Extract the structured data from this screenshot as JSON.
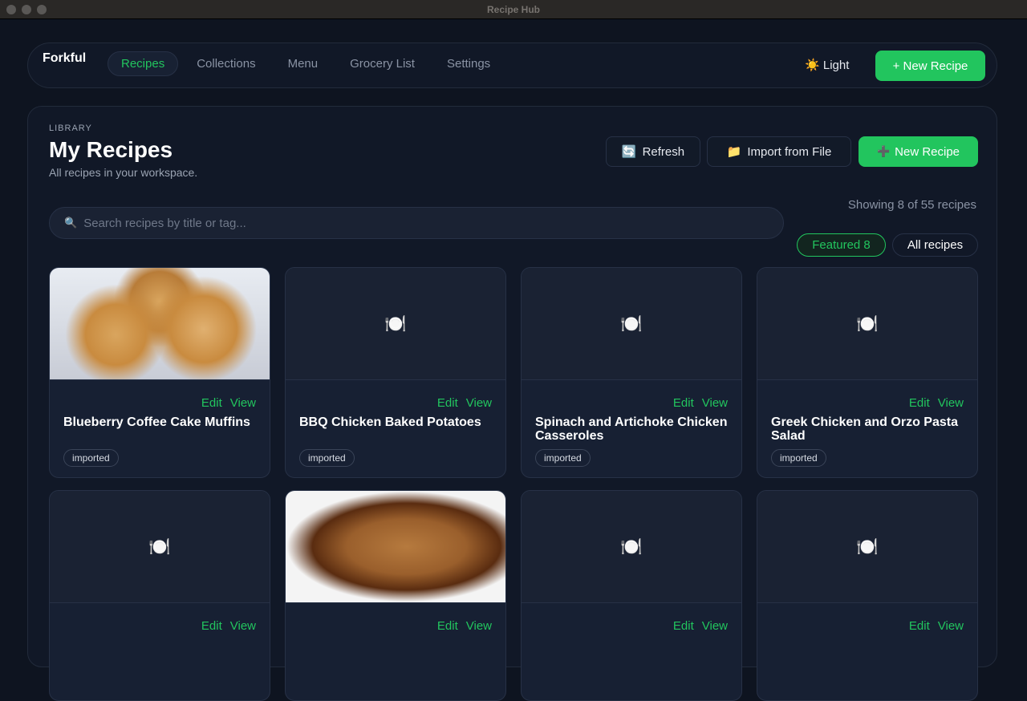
{
  "window": {
    "title": "Recipe Hub"
  },
  "nav": {
    "brand": "Forkful",
    "links": [
      "Recipes",
      "Collections",
      "Menu",
      "Grocery List",
      "Settings"
    ],
    "theme_icon": "☀️",
    "theme_label": "Light",
    "new_recipe": "+ New Recipe"
  },
  "page": {
    "eyebrow": "LIBRARY",
    "title": "My Recipes",
    "subtitle": "All recipes in your workspace.",
    "refresh_icon": "🔄",
    "refresh": "Refresh",
    "import_icon": "📁",
    "import": "Import from File",
    "new_icon": "➕",
    "new_recipe": "New Recipe",
    "search_icon": "🔍",
    "search_placeholder": "Search recipes by title or tag...",
    "showing": "Showing 8 of 55 recipes",
    "filters": [
      "Featured 8",
      "All recipes"
    ]
  },
  "placeholder_icon": "🍽️",
  "card_actions": {
    "edit": "Edit",
    "view": "View"
  },
  "recipes": [
    {
      "title": "Blueberry Coffee Cake Muffins",
      "tag": "imported",
      "image": "muffin"
    },
    {
      "title": "BBQ Chicken Baked Potatoes",
      "tag": "imported",
      "image": ""
    },
    {
      "title": "Spinach and Artichoke Chicken Casseroles",
      "tag": "imported",
      "image": ""
    },
    {
      "title": "Greek Chicken and Orzo Pasta Salad",
      "tag": "imported",
      "image": ""
    },
    {
      "title": "",
      "tag": "",
      "image": ""
    },
    {
      "title": "",
      "tag": "",
      "image": "fish"
    },
    {
      "title": "",
      "tag": "",
      "image": ""
    },
    {
      "title": "",
      "tag": "",
      "image": ""
    }
  ],
  "colors": {
    "accent": "#22c55e",
    "bg": "#0e1420",
    "card": "#172033"
  }
}
